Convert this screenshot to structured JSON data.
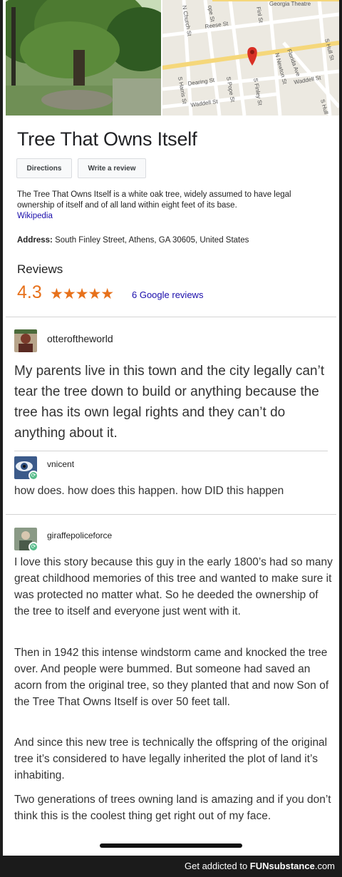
{
  "place": {
    "title": "Tree That Owns Itself",
    "directions_label": "Directions",
    "write_review_label": "Write a review",
    "description": "The Tree That Owns Itself is a white oak tree, widely assumed to have legal ownership of itself and of all land within eight feet of its base.",
    "description_source": "Wikipedia",
    "address_label": "Address:",
    "address": "South Finley Street, Athens, GA 30605, United States",
    "reviews_heading": "Reviews",
    "rating": "4.3",
    "stars_text": "★★★★★",
    "review_count": "6 Google reviews",
    "star_color": "#e7711b"
  },
  "map": {
    "streets": [
      "Georgia Theatre",
      "Reese St",
      "Dearing St",
      "Waddell St",
      "Waddell St",
      "Waddell St",
      "N Church St",
      "S Harris St",
      "S Pope St",
      "S Finley St",
      "N Newton St",
      "Florida Ave",
      "S Hull St",
      "S Hull",
      "Finl St",
      "ope St"
    ]
  },
  "thread": {
    "posts": [
      {
        "user": "otteroftheworld",
        "text": "My parents live in this town and the city legally can’t tear the tree down to build or anything because the tree has its own legal rights and they can’t do anything about it."
      },
      {
        "user": "vnicent",
        "text": "how does. how does this happen. how DID this happen"
      },
      {
        "user": "giraffepoliceforce",
        "paragraphs": [
          "I love this story because this guy in the early 1800’s had so many great childhood memories of this tree and wanted to make sure it was protected no matter what. So he deeded the ownership of the tree to itself and everyone just went with it.",
          "Then in 1942 this intense windstorm came and knocked the tree over. And people were bummed. But someone had saved an acorn from the original tree, so they planted that and now Son of the Tree That Owns Itself is over 50 feet tall.",
          "And since this new tree is technically the offspring of the original tree it’s considered to have legally inherited the plot of land it’s inhabiting.",
          "Two generations of trees owning land is amazing and if you don’t think this is the coolest thing get right out of my face."
        ]
      }
    ]
  },
  "footer": {
    "prefix": "Get addicted to ",
    "brand": "FUNsubstance",
    "suffix": ".com"
  }
}
